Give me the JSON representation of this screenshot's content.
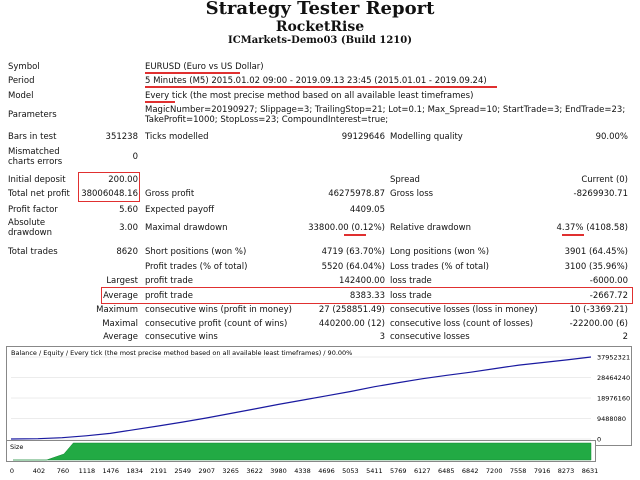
{
  "header": {
    "title": "Strategy Tester Report",
    "ea_name": "RocketRise",
    "account": "ICMarkets-Demo03 (Build 1210)"
  },
  "params": {
    "symbol_label": "Symbol",
    "symbol_value": "EURUSD (Euro vs US Dollar)",
    "period_label": "Period",
    "period_value": "5 Minutes (M5) 2015.01.02 09:00 - 2019.09.13 23:45 (2015.01.01 - 2019.09.24)",
    "model_label": "Model",
    "model_value": "Every tick (the most precise method based on all available least timeframes)",
    "parameters_label": "Parameters",
    "parameters_line1": "MagicNumber=20190927; Slippage=3; TrailingStop=21; Lot=0.1; Max_Spread=10; StartTrade=3; EndTrade=23;",
    "parameters_line2": "TakeProfit=1000; StopLoss=23; CompoundInterest=true;"
  },
  "stats": {
    "bars_label": "Bars in test",
    "bars_value": "351238",
    "ticks_label": "Ticks modelled",
    "ticks_value": "99129646",
    "quality_label": "Modelling quality",
    "quality_value": "90.00%",
    "mismatch_label1": "Mismatched",
    "mismatch_label2": "charts errors",
    "mismatch_value": "0",
    "deposit_label": "Initial deposit",
    "deposit_value": "200.00",
    "spread_label": "Spread",
    "spread_value": "Current (0)",
    "net_label": "Total net profit",
    "net_value": "38006048.16",
    "gross_profit_label": "Gross profit",
    "gross_profit_value": "46275978.87",
    "gross_loss_label": "Gross loss",
    "gross_loss_value": "-8269930.71",
    "pf_label": "Profit factor",
    "pf_value": "5.60",
    "payoff_label": "Expected payoff",
    "payoff_value": "4409.05",
    "abs_dd_label1": "Absolute",
    "abs_dd_label2": "drawdown",
    "abs_dd_value": "3.00",
    "max_dd_label": "Maximal drawdown",
    "max_dd_value": "33800.00 (0.12%)",
    "rel_dd_label": "Relative drawdown",
    "rel_dd_value": "4.37% (4108.58)",
    "trades_label": "Total trades",
    "trades_value": "8620",
    "short_label": "Short positions (won %)",
    "short_value": "4719 (63.70%)",
    "long_label": "Long positions (won %)",
    "long_value": "3901 (64.45%)",
    "pt_label": "Profit trades (% of total)",
    "pt_value": "5520 (64.04%)",
    "lt_label": "Loss trades (% of total)",
    "lt_value": "3100 (35.96%)",
    "largest_label": "Largest",
    "largest_profit_label": "profit trade",
    "largest_profit_value": "142400.00",
    "largest_loss_label": "loss trade",
    "largest_loss_value": "-6000.00",
    "avg_label": "Average",
    "avg_profit_label": "profit trade",
    "avg_profit_value": "8383.33",
    "avg_loss_label": "loss trade",
    "avg_loss_value": "-2667.72",
    "max_label": "Maximum",
    "max_cw_label": "consecutive wins (profit in money)",
    "max_cw_value": "27 (258851.49)",
    "max_cl_label": "consecutive losses (loss in money)",
    "max_cl_value": "10 (-3369.21)",
    "maximal_label": "Maximal",
    "maximal_cp_label": "consecutive profit (count of wins)",
    "maximal_cp_value": "440200.00 (12)",
    "maximal_cl_label": "consecutive loss (count of losses)",
    "maximal_cl_value": "-22200.00 (6)",
    "avgc_label": "Average",
    "avgc_w_label": "consecutive wins",
    "avgc_w_value": "3",
    "avgc_l_label": "consecutive losses",
    "avgc_l_value": "2"
  },
  "chart_data": {
    "type": "line",
    "legend_text": "Balance / Equity / Every tick (the most precise method based on all available least timeframes) / 90.00%",
    "y_ticks": [
      "37952321",
      "28464240",
      "18976160",
      "9488080",
      "0"
    ],
    "x_ticks": [
      "0",
      "402",
      "760",
      "1118",
      "1476",
      "1834",
      "2191",
      "2549",
      "2907",
      "3265",
      "3622",
      "3980",
      "4338",
      "4696",
      "5053",
      "5411",
      "5769",
      "6127",
      "6485",
      "6842",
      "7200",
      "7558",
      "7916",
      "8273",
      "8631"
    ],
    "ylim": [
      0,
      37952321
    ],
    "xlim": [
      0,
      8631
    ],
    "series": [
      {
        "name": "Balance",
        "color": "#1a1aa0",
        "points": [
          [
            0,
            0
          ],
          [
            402,
            150000
          ],
          [
            760,
            600000
          ],
          [
            1118,
            1500000
          ],
          [
            1476,
            2600000
          ],
          [
            1834,
            4300000
          ],
          [
            2191,
            6000000
          ],
          [
            2549,
            7800000
          ],
          [
            2907,
            9700000
          ],
          [
            3265,
            11800000
          ],
          [
            3622,
            13900000
          ],
          [
            3980,
            16000000
          ],
          [
            4338,
            18000000
          ],
          [
            4696,
            20000000
          ],
          [
            5053,
            22000000
          ],
          [
            5411,
            24200000
          ],
          [
            5769,
            26100000
          ],
          [
            6127,
            27900000
          ],
          [
            6485,
            29500000
          ],
          [
            6842,
            30900000
          ],
          [
            7200,
            32600000
          ],
          [
            7558,
            34200000
          ],
          [
            7916,
            35400000
          ],
          [
            8273,
            36600000
          ],
          [
            8631,
            37950000
          ]
        ]
      }
    ],
    "size_label": "Size"
  },
  "colors": {
    "highlight": "#e03030",
    "balance": "#1a1aa0",
    "size_bar": "#22aa44"
  }
}
